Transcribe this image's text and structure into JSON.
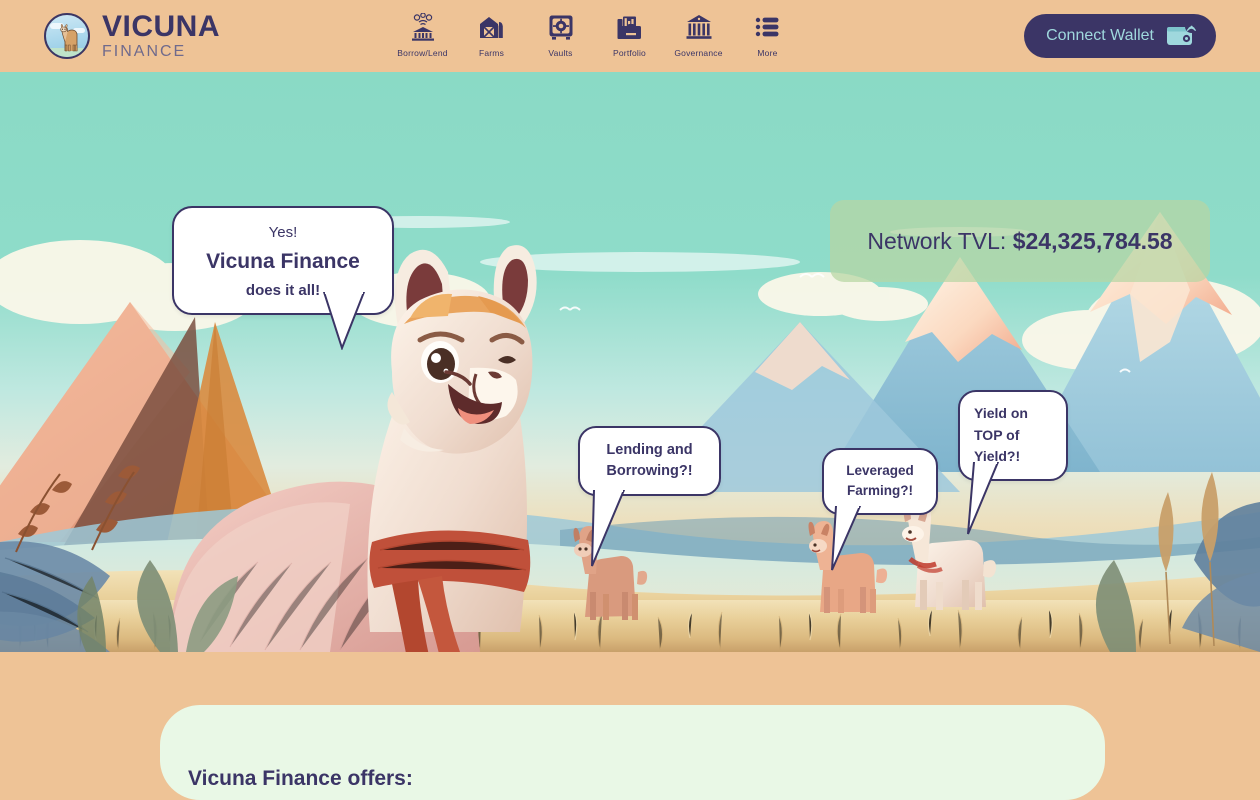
{
  "header": {
    "logo": {
      "icon": "llama-badge-icon",
      "title": "VICUNA",
      "subtitle": "FINANCE"
    },
    "nav_items": [
      {
        "label": "Borrow/Lend",
        "icon": "bank-coins-icon"
      },
      {
        "label": "Farms",
        "icon": "barn-silo-icon"
      },
      {
        "label": "Vaults",
        "icon": "safe-vault-icon"
      },
      {
        "label": "Portfolio",
        "icon": "briefcase-chart-icon"
      },
      {
        "label": "Governance",
        "icon": "classical-building-icon"
      },
      {
        "label": "More",
        "icon": "list-bullets-icon"
      }
    ],
    "wallet_button": {
      "label": "Connect Wallet",
      "icon": "wallet-signal-icon"
    }
  },
  "hero": {
    "tvl": {
      "prefix": "Network TVL: ",
      "value": "$24,325,784.58"
    },
    "bubbles": {
      "main": {
        "line1": "Yes!",
        "line2": "Vicuna Finance",
        "line3": "does it all!"
      },
      "lending": {
        "line1": "Lending and",
        "line2": "Borrowing?!"
      },
      "farming": {
        "line1": "Leveraged",
        "line2": "Farming?!"
      },
      "yield": {
        "line1": "Yield on",
        "line2": "TOP of",
        "line3": "Yield?!"
      }
    }
  },
  "offers": {
    "title": "Vicuna Finance offers:"
  },
  "colors": {
    "header_bg": "#eec396",
    "brand_navy": "#3b3566",
    "wallet_accent": "#9fd8dd",
    "sky": "#8ddbc8",
    "card_mint": "#e9f8e6",
    "tvl_green": "#b7d6a3"
  }
}
